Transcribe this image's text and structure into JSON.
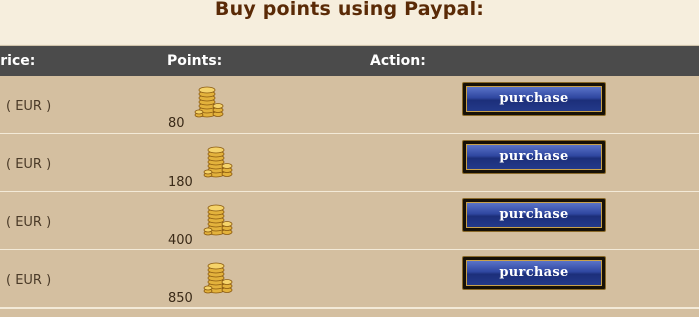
{
  "page": {
    "heading": "Buy points using Paypal:"
  },
  "table": {
    "columns": {
      "price": "Price:",
      "points": "Points:",
      "action": "Action:"
    },
    "rows": [
      {
        "price": "( EUR )",
        "points": "80",
        "action": "purchase"
      },
      {
        "price": "( EUR )",
        "points": "180",
        "action": "purchase"
      },
      {
        "price": "( EUR )",
        "points": "400",
        "action": "purchase"
      },
      {
        "price": "( EUR )",
        "points": "850",
        "action": "purchase"
      }
    ]
  },
  "icons": {
    "coin": "coin-stack-icon"
  },
  "colors": {
    "header_bg": "#4b4b4b",
    "row_bg": "#d4bfa0",
    "heading_text": "#5a2a06",
    "button_blue": "#2f47a0",
    "button_border_gold": "#c9a14a"
  }
}
